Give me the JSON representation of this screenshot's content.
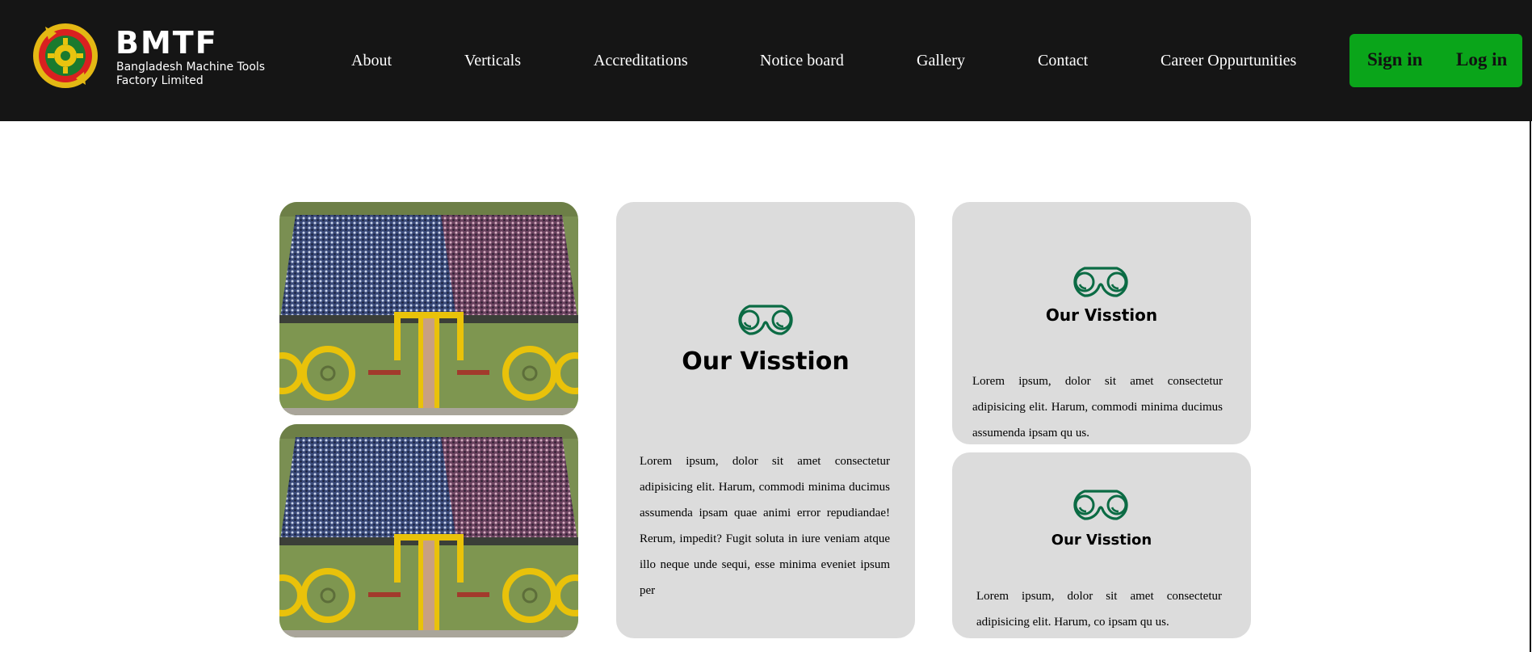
{
  "brand": {
    "title": "BMTF",
    "subtitle": "Bangladesh Machine Tools Factory Limited",
    "logo_icon": "gear-emblem-icon"
  },
  "nav": {
    "items": [
      {
        "label": "About"
      },
      {
        "label": "Verticals"
      },
      {
        "label": "Accreditations"
      },
      {
        "label": "Notice board"
      },
      {
        "label": "Gallery"
      },
      {
        "label": "Contact"
      },
      {
        "label": "Career Oppurtunities"
      }
    ]
  },
  "auth": {
    "signin_label": "Sign in",
    "login_label": "Log in"
  },
  "gallery": {
    "photo_icon": "crowd-formation-photo"
  },
  "cards": {
    "main": {
      "title": "Our Visstion",
      "text": "Lorem ipsum, dolor sit amet consectetur adipisicing elit. Harum, commodi minima ducimus assumenda ipsam quae animi error repudiandae! Rerum, impedit? Fugit soluta in iure veniam atque illo neque unde sequi, esse minima eveniet ipsum per"
    },
    "top": {
      "title": "Our Visstion",
      "text": "Lorem ipsum, dolor sit amet consectetur adipisicing elit. Harum, commodi minima ducimus assumenda ipsam qu us."
    },
    "bottom": {
      "title": "Our Visstion",
      "text": "Lorem ipsum, dolor sit amet consectetur adipisicing elit. Harum, co ipsam qu us."
    }
  },
  "icons": {
    "card_icon": "binoculars-icon"
  },
  "colors": {
    "header_bg": "#151515",
    "accent_green": "#0aa51a",
    "icon_green": "#0b6b44",
    "card_bg": "#dcdcdc"
  }
}
